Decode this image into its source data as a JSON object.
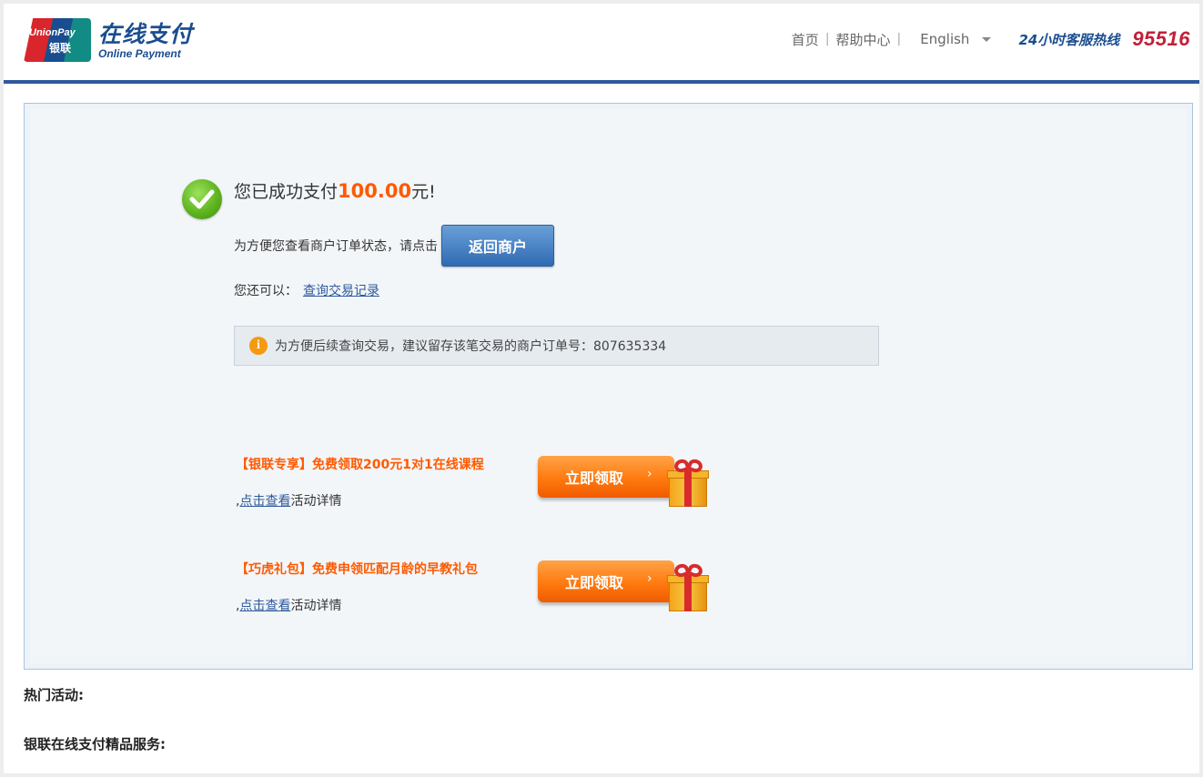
{
  "header": {
    "logo": {
      "mark_line1": "UnionPay",
      "mark_line2": "银联",
      "title_cn": "在线支付",
      "title_en": "Online Payment"
    },
    "nav": {
      "home": "首页",
      "separator": "|",
      "help": "帮助中心",
      "language": "English",
      "hotline_label": "24小时客服热线",
      "hotline_number": "95516"
    },
    "accent_color": "#2e5a9c"
  },
  "result": {
    "prefix": "您已成功支付",
    "amount": "100.00",
    "suffix": "元!",
    "return_prompt": "为方便您查看商户订单状态，请点击",
    "return_button": "返回商户",
    "also_label": "您还可以：",
    "query_link": "查询交易记录",
    "notice_text": "为方便后续查询交易，建议留存该笔交易的商户订单号：807635334",
    "amount_color": "#ff5a00"
  },
  "promotions": [
    {
      "title": "【银联专享】免费领取200元1对1在线课程",
      "detail_prefix": ",",
      "detail_link": "点击查看",
      "detail_suffix": "活动详情",
      "button": "立即领取"
    },
    {
      "title": "【巧虎礼包】免费申领匹配月龄的早教礼包",
      "detail_prefix": ",",
      "detail_link": "点击查看",
      "detail_suffix": "活动详情",
      "button": "立即领取"
    }
  ],
  "sections": {
    "hot_activities": "热门活动:",
    "premium_services": "银联在线支付精品服务:"
  }
}
